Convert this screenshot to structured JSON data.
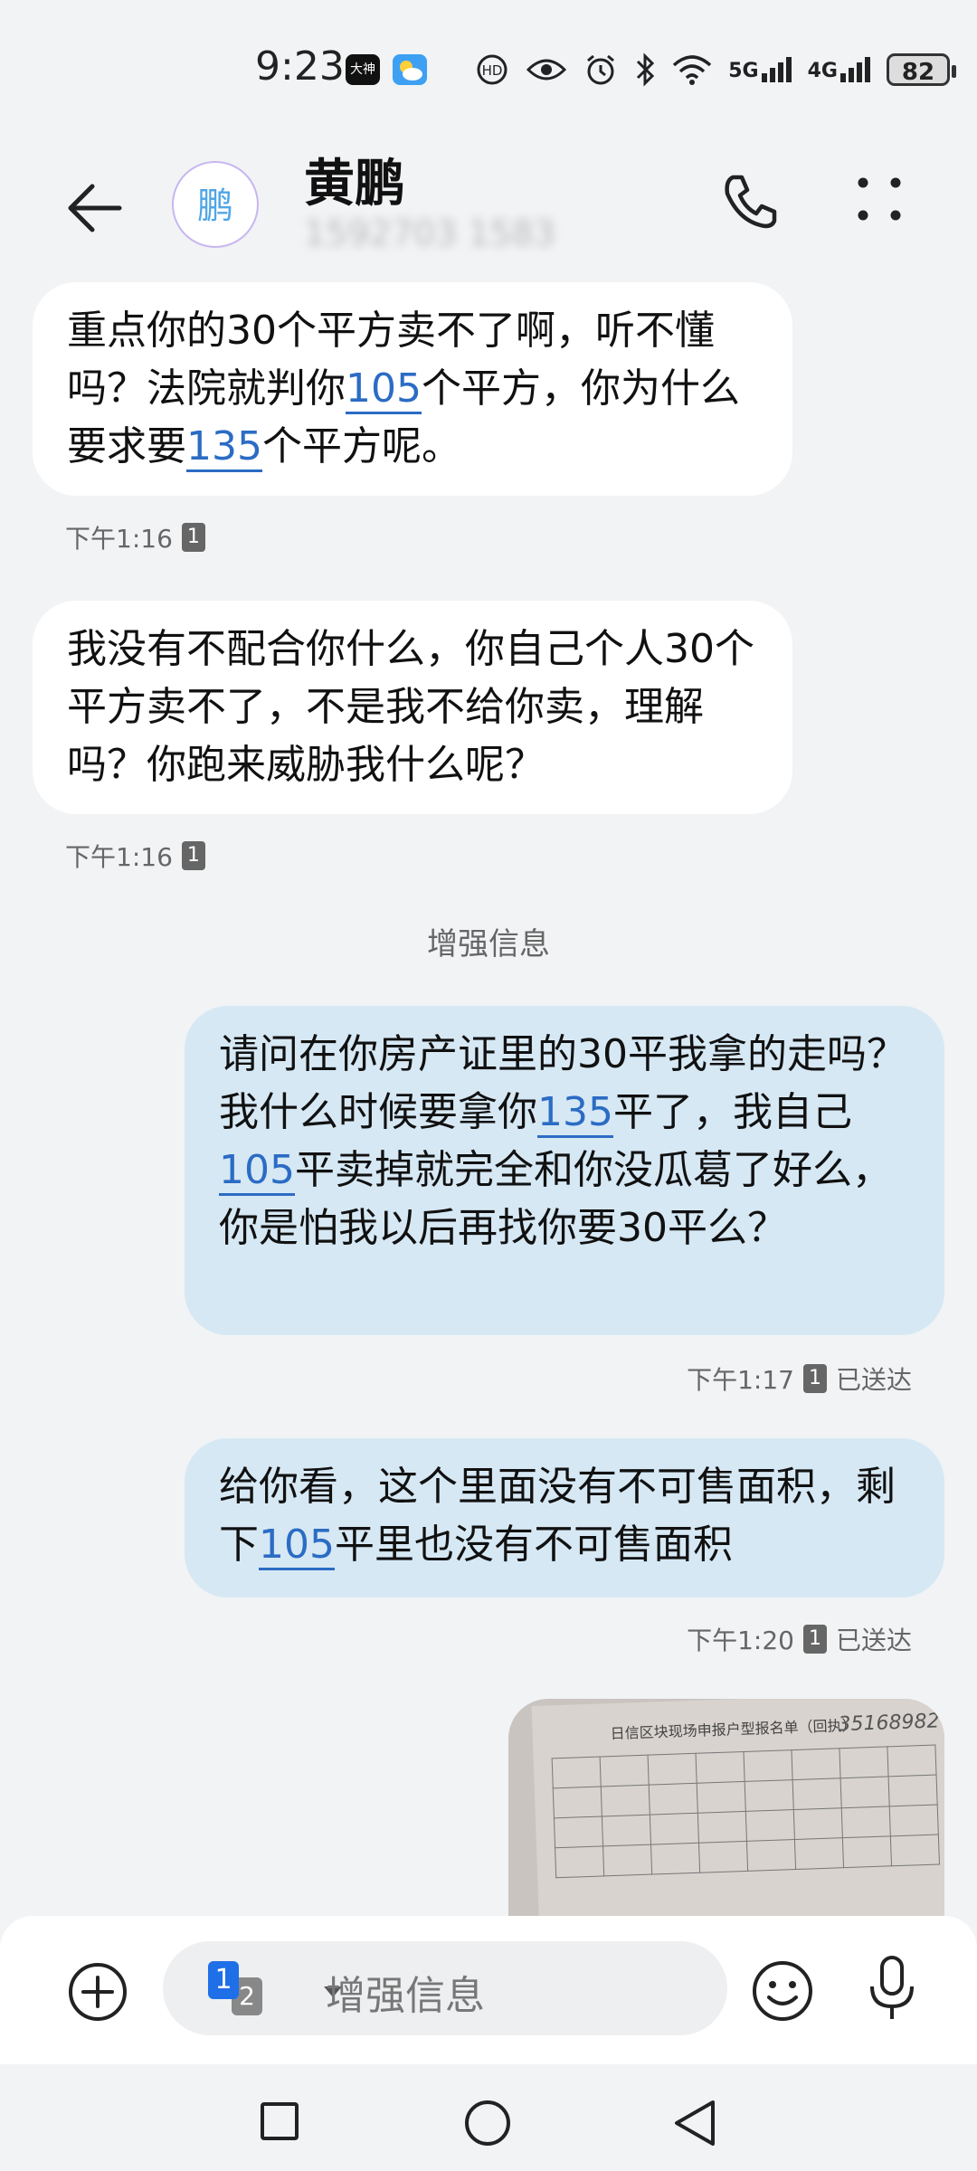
{
  "status_bar": {
    "time": "9:23",
    "app_badge": "大神",
    "battery": "82",
    "net1": "5G",
    "net2": "4G"
  },
  "header": {
    "avatar_text": "鹏",
    "contact_name": "黄鹏",
    "contact_number_masked": "1592703 1583"
  },
  "messages": [
    {
      "direction": "incoming",
      "parts": [
        "重点你的30个平方卖不了啊，听不懂吗？法院就判你",
        "105",
        "个平方，你为什么要求要",
        "135",
        "个平方呢。"
      ],
      "time": "下午1:16",
      "sim": "1"
    },
    {
      "direction": "incoming",
      "text": "我没有不配合你什么，你自己个人30个平方卖不了，不是我不给你卖，理解吗？你跑来威胁我什么呢？",
      "time": "下午1:16",
      "sim": "1"
    },
    {
      "direction": "outgoing",
      "parts": [
        "请问在你房产证里的30平我拿的走吗？我什么时候要拿你",
        "135",
        "平了，我自己",
        "105",
        "平卖掉就完全和你没瓜葛了好么，你是怕我以后再找你要30平么？"
      ],
      "time": "下午1:17",
      "sim": "1",
      "status": "已送达"
    },
    {
      "direction": "outgoing",
      "parts": [
        "给你看，这个里面没有不可售面积，剩下",
        "105",
        "平里也没有不可售面积"
      ],
      "time": "下午1:20",
      "sim": "1",
      "status": "已送达"
    }
  ],
  "center_label": "增强信息",
  "photo": {
    "title": "日信区块现场申报户型报名单（回执）",
    "handwritten": "35168982"
  },
  "composer": {
    "sim_primary": "1",
    "sim_secondary": "2",
    "placeholder": "增强信息"
  }
}
